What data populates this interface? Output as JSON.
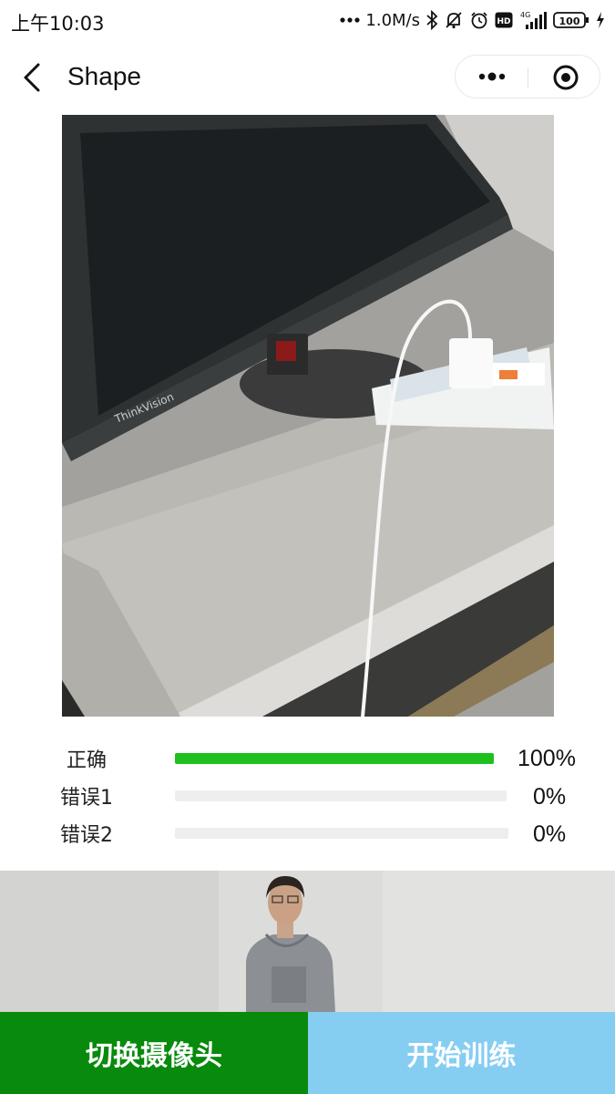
{
  "status_bar": {
    "time": "上午10:03",
    "network_speed": "1.0M/s",
    "battery": "100",
    "icons": [
      "dots-icon",
      "bluetooth-icon",
      "mute-icon",
      "alarm-icon",
      "hd-icon",
      "signal-4g-icon",
      "battery-icon",
      "charging-icon"
    ]
  },
  "nav": {
    "title": "Shape",
    "back_icon": "chevron-left-icon",
    "more_icon": "more-dots-icon",
    "close_icon": "target-icon"
  },
  "predictions": [
    {
      "label": "正确",
      "value_text": "100%",
      "value": 1.0,
      "color": "#1ec01e"
    },
    {
      "label": "错误1",
      "value_text": "0%",
      "value": 0.0,
      "color": "#1ec01e"
    },
    {
      "label": "错误2",
      "value_text": "0%",
      "value": 0.0,
      "color": "#1ec01e"
    }
  ],
  "buttons": {
    "switch_camera": "切换摄像头",
    "start_training": "开始训练"
  },
  "colors": {
    "switch_bg": "#088a0c",
    "train_bg": "#86cdf2",
    "bar_fill": "#1ec01e",
    "bar_track": "#eeeeee"
  }
}
